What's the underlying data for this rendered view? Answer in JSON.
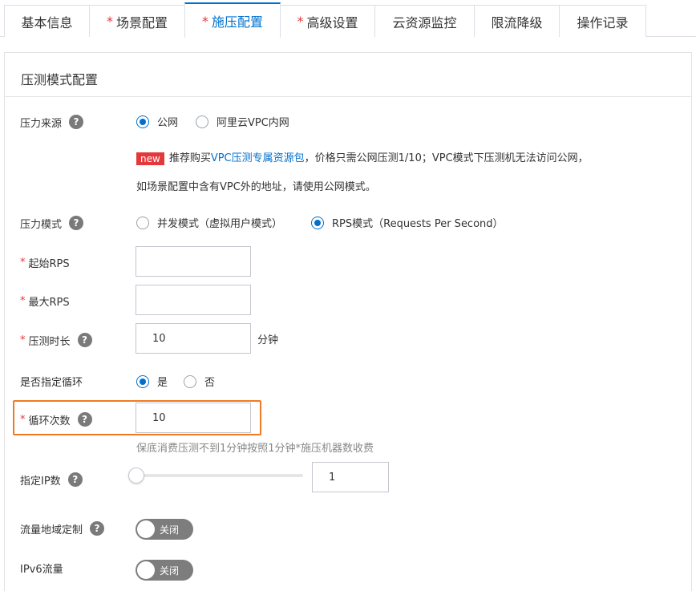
{
  "tabs": [
    {
      "label": "基本信息",
      "required": false,
      "active": false
    },
    {
      "label": "场景配置",
      "required": true,
      "active": false
    },
    {
      "label": "施压配置",
      "required": true,
      "active": true
    },
    {
      "label": "高级设置",
      "required": true,
      "active": false
    },
    {
      "label": "云资源监控",
      "required": false,
      "active": false
    },
    {
      "label": "限流降级",
      "required": false,
      "active": false
    },
    {
      "label": "操作记录",
      "required": false,
      "active": false
    }
  ],
  "required_mark": "*",
  "panel": {
    "title": "压测模式配置"
  },
  "pressure_source": {
    "label": "压力来源",
    "options": [
      "公网",
      "阿里云VPC内网"
    ],
    "selected": "公网",
    "new_badge": "new",
    "note_prefix": "推荐购买",
    "note_link": "VPC压测专属资源包",
    "note_suffix": "，价格只需公网压测1/10；VPC模式下压测机无法访问公网，",
    "note_line2": "如场景配置中含有VPC外的地址，请使用公网模式。"
  },
  "pressure_mode": {
    "label": "压力模式",
    "options": [
      "并发模式（虚拟用户模式）",
      "RPS模式（Requests Per Second）"
    ],
    "selected": "RPS模式（Requests Per Second）"
  },
  "start_rps": {
    "label": "起始RPS",
    "value": ""
  },
  "max_rps": {
    "label": "最大RPS",
    "value": ""
  },
  "duration": {
    "label": "压测时长",
    "value": "10",
    "unit": "分钟"
  },
  "loop": {
    "label": "是否指定循环",
    "options": [
      "是",
      "否"
    ],
    "selected": "是"
  },
  "loop_count": {
    "label": "循环次数",
    "value": "10",
    "hint": "保底消费压测不到1分钟按照1分钟*施压机器数收费"
  },
  "ip_count": {
    "label": "指定IP数",
    "value": "1",
    "slider_level": 0
  },
  "region_custom": {
    "label": "流量地域定制",
    "switch_text": "关闭",
    "on": false
  },
  "ipv6": {
    "label": "IPv6流量",
    "switch_text": "关闭",
    "on": false
  },
  "colors": {
    "accent": "#0070cc",
    "required": "#e4393c",
    "highlight": "#f07a24",
    "switch_off": "#7d7d7d"
  }
}
